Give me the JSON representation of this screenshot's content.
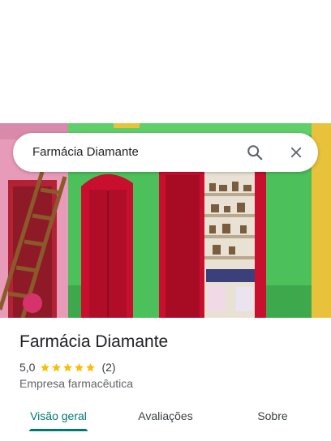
{
  "search": {
    "query": "Farmácia Diamante"
  },
  "place": {
    "name": "Farmácia Diamante",
    "rating_value": "5,0",
    "rating_stars": 5,
    "review_count": "(2)",
    "category": "Empresa farmacêutica"
  },
  "tabs": [
    {
      "label": "Visão geral",
      "active": true
    },
    {
      "label": "Avaliações",
      "active": false
    },
    {
      "label": "Sobre",
      "active": false
    }
  ],
  "icons": {
    "search": "search-icon",
    "close": "close-icon",
    "star": "star-icon"
  },
  "colors": {
    "accent": "#01796f",
    "star": "#fbbc04",
    "wall_green": "#4cc05a",
    "wall_pink": "#e79bb8",
    "door_red": "#c8102e"
  }
}
